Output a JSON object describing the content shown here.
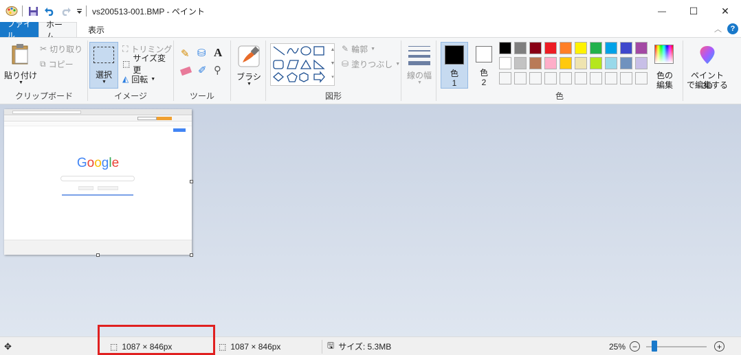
{
  "window": {
    "title": "vs200513-001.BMP - ペイント",
    "minimize": "—",
    "maximize": "☐",
    "close": "✕"
  },
  "tabs": {
    "file": "ファイル",
    "home": "ホーム",
    "view": "表示"
  },
  "ribbon": {
    "clipboard": {
      "paste": "貼り付け",
      "cut": "切り取り",
      "copy": "コピー",
      "label": "クリップボード"
    },
    "image": {
      "select": "選択",
      "crop": "トリミング",
      "resize": "サイズ変更",
      "rotate": "回転",
      "label": "イメージ"
    },
    "tools": {
      "label": "ツール"
    },
    "brushes": {
      "label": "ブラシ"
    },
    "shapes": {
      "outline": "輪郭",
      "fill": "塗りつぶし",
      "label": "図形"
    },
    "size": {
      "label": "線の幅"
    },
    "colors": {
      "color1": "色",
      "color1_num": "1",
      "color2": "色",
      "color2_num": "2",
      "edit_line1": "色の",
      "edit_line2": "編集",
      "label": "色",
      "palette_row1": [
        "#000000",
        "#7f7f7f",
        "#880015",
        "#ed1c24",
        "#ff7f27",
        "#fff200",
        "#22b14c",
        "#00a2e8",
        "#3f48cc",
        "#a349a4"
      ],
      "palette_row2": [
        "#ffffff",
        "#c3c3c3",
        "#b97a57",
        "#ffaec9",
        "#ffc90e",
        "#efe4b0",
        "#b5e61d",
        "#99d9ea",
        "#7092be",
        "#c8bfe7"
      ]
    },
    "paint3d": {
      "line1": "ペイント 3D",
      "line2": "で編集する"
    }
  },
  "canvas_preview": {
    "logo": "Google"
  },
  "statusbar": {
    "selection_size": "1087 × 846px",
    "image_size": "1087 × 846px",
    "file_size": "サイズ: 5.3MB",
    "zoom": "25%"
  }
}
